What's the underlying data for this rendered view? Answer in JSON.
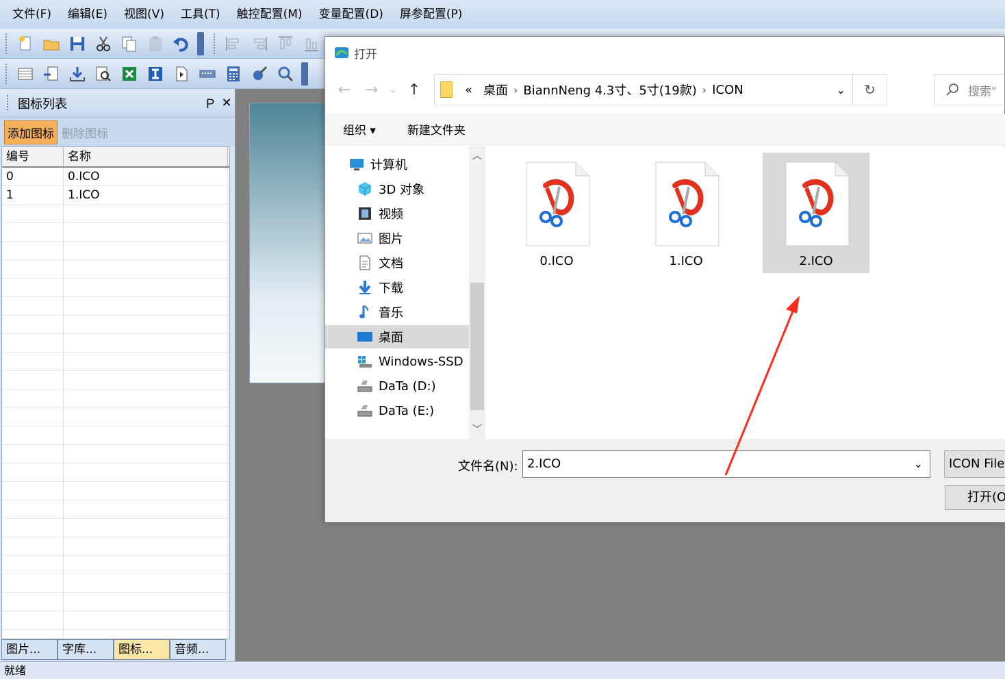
{
  "menu": [
    "文件(F)",
    "编辑(E)",
    "视图(V)",
    "工具(T)",
    "触控配置(M)",
    "变量配置(D)",
    "屏参配置(P)"
  ],
  "panel": {
    "title": "图标列表",
    "pin": "Ｐ",
    "close": "✕",
    "add_button": "添加图标",
    "delete_button": "删除图标",
    "columns": [
      "编号",
      "名称"
    ],
    "rows": [
      {
        "id": "0",
        "name": "0.ICO"
      },
      {
        "id": "1",
        "name": "1.ICO"
      }
    ],
    "tabs": [
      "图片...",
      "字库...",
      "图标...",
      "音频..."
    ],
    "active_tab": 2
  },
  "status": "就绪",
  "dialog": {
    "title": "打开",
    "path_prefix": "«",
    "path": [
      "桌面",
      "BiannNeng 4.3寸、5寸(19款)",
      "ICON"
    ],
    "search_placeholder": "搜索\"",
    "organize": "组织 ▾",
    "new_folder": "新建文件夹",
    "nav": [
      {
        "label": "计算机",
        "icon": "computer-icon"
      },
      {
        "label": "3D 对象",
        "icon": "cube-icon"
      },
      {
        "label": "视频",
        "icon": "video-icon"
      },
      {
        "label": "图片",
        "icon": "picture-icon"
      },
      {
        "label": "文档",
        "icon": "document-icon"
      },
      {
        "label": "下载",
        "icon": "download-icon"
      },
      {
        "label": "音乐",
        "icon": "music-icon"
      },
      {
        "label": "桌面",
        "icon": "desktop-icon"
      },
      {
        "label": "Windows-SSD",
        "icon": "drive-icon"
      },
      {
        "label": "DaTa (D:)",
        "icon": "drive-icon"
      },
      {
        "label": "DaTa (E:)",
        "icon": "drive-icon"
      }
    ],
    "selected_nav": 7,
    "files": [
      "0.ICO",
      "1.ICO",
      "2.ICO"
    ],
    "selected_file": 2,
    "filename_label": "文件名(N):",
    "filename_value": "2.ICO",
    "filetype": "ICON File",
    "open_button": "打开(O"
  },
  "colors": {
    "accent_orange": "#f7b05a",
    "arrow_red": "#ff2b1c",
    "selection_gray": "#d9d9d9"
  }
}
